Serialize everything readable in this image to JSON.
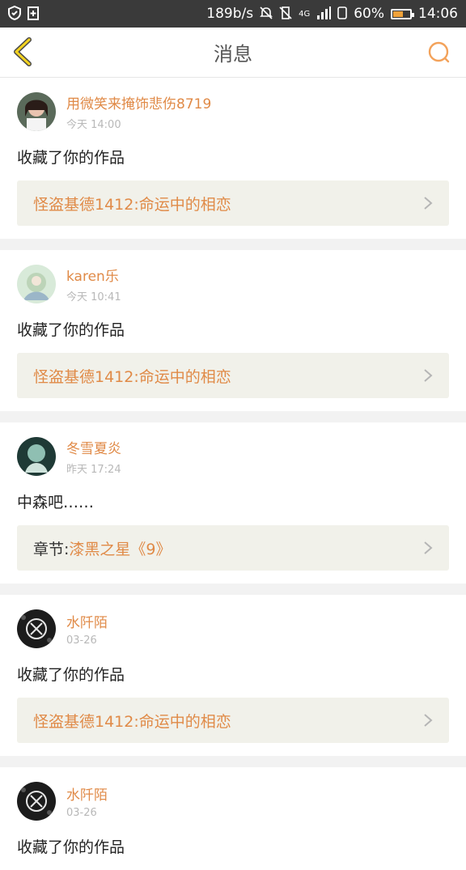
{
  "status_bar": {
    "speed": "189b/s",
    "network": "4G",
    "battery_pct": "60%",
    "battery_level": 0.6,
    "time": "14:06"
  },
  "header": {
    "title": "消息"
  },
  "messages": [
    {
      "user": "用微笑来掩饰悲伤8719",
      "time": "今天 14:00",
      "text": "收藏了你的作品",
      "work_prefix": "",
      "work": "怪盗基德1412:命运中的相恋"
    },
    {
      "user": "karen乐",
      "time": "今天 10:41",
      "text": "收藏了你的作品",
      "work_prefix": "",
      "work": "怪盗基德1412:命运中的相恋"
    },
    {
      "user": "冬雪夏炎",
      "time": "昨天 17:24",
      "text": "中森吧……",
      "work_prefix": "章节:",
      "work": "漆黑之星《9》"
    },
    {
      "user": "水阡陌",
      "time": "03-26",
      "text": "收藏了你的作品",
      "work_prefix": "",
      "work": "怪盗基德1412:命运中的相恋"
    },
    {
      "user": "水阡陌",
      "time": "03-26",
      "text": "收藏了你的作品",
      "work_prefix": "",
      "work": ""
    }
  ],
  "colors": {
    "accent": "#e08a47",
    "header_bg": "#ffffff",
    "statusbar_bg": "#3a3a3a"
  }
}
